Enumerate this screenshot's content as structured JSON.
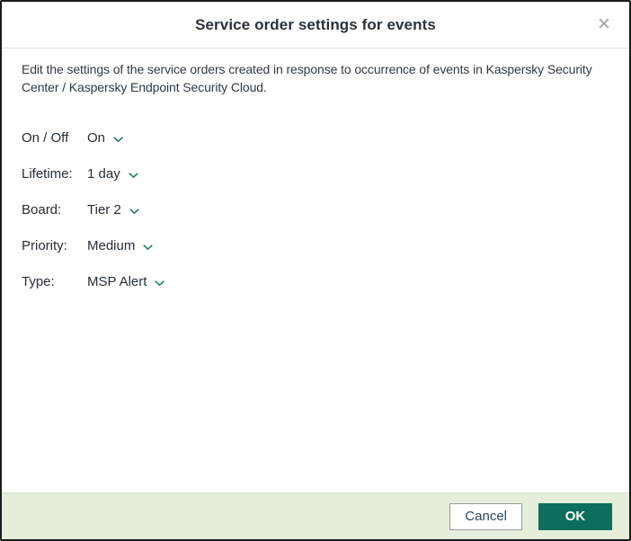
{
  "dialog": {
    "title": "Service order settings for events",
    "close_icon": "✕",
    "description": "Edit the settings of the service orders created in response to occurrence of events in Kaspersky Security Center / Kaspersky Endpoint Security Cloud.",
    "fields": [
      {
        "label": "On / Off",
        "value": "On"
      },
      {
        "label": "Lifetime:",
        "value": "1 day"
      },
      {
        "label": "Board:",
        "value": "Tier 2"
      },
      {
        "label": "Priority:",
        "value": "Medium"
      },
      {
        "label": "Type:",
        "value": "MSP Alert"
      }
    ],
    "footer": {
      "cancel_label": "Cancel",
      "ok_label": "OK"
    },
    "icons": {
      "dropdown_indicator": "chevron-down-icon"
    },
    "colors": {
      "ok_button_bg": "#0e6e5e",
      "footer_bg": "#e5eeda",
      "chevron_teal": "#1f7a68",
      "title_text": "#2a323c",
      "body_text": "#2e3a45",
      "cancel_text": "#2b4a5e",
      "dialog_border": "#1b1b1b"
    }
  }
}
